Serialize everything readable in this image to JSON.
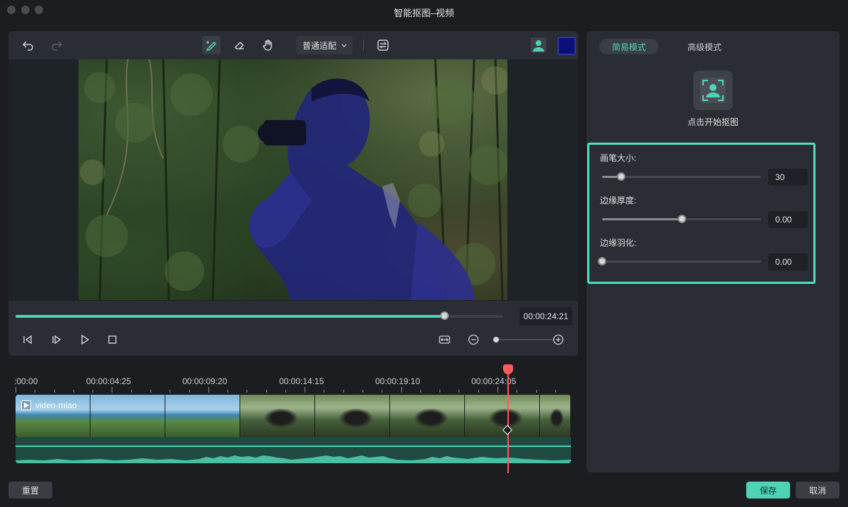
{
  "window": {
    "title": "智能抠图–视频"
  },
  "toolbar": {
    "fit_mode": "普通适配",
    "brush_color": "#0b0f7c",
    "icons": [
      "undo-icon",
      "redo-icon",
      "smart-brush-icon",
      "eraser-icon",
      "hand-icon",
      "chevron-down-icon",
      "swap-icon",
      "person-icon"
    ]
  },
  "player": {
    "timecode": "00:00:24:21",
    "progress": 0.88,
    "zoom": 0.0,
    "icons": [
      "prev-frame-icon",
      "next-frame-icon",
      "play-icon",
      "stop-icon",
      "fit-timeline-icon",
      "zoom-out-icon",
      "zoom-in-icon"
    ]
  },
  "timeline": {
    "ruler_labels": [
      ":00:00",
      "00:00:04:25",
      "00:00:09:20",
      "00:00:14:15",
      "00:00:19:10",
      "00:00:24:05"
    ],
    "clip_name": "video-miao",
    "playhead": "00:00:24:21"
  },
  "panel": {
    "tabs": {
      "simple": "简易模式",
      "advanced": "高级模式"
    },
    "cutout_label": "点击开始抠图",
    "brush_size": {
      "label": "画笔大小:",
      "value": "30",
      "level": 0.12
    },
    "edge_thickness": {
      "label": "边缘厚度:",
      "value": "0.00",
      "level": 0.5
    },
    "edge_feather": {
      "label": "边缘羽化:",
      "value": "0.00",
      "level": 0.0
    }
  },
  "buttons": {
    "reset": "重置",
    "save": "保存",
    "cancel": "取消"
  },
  "colors": {
    "accent": "#4fd3b6",
    "playhead": "#ff5a5a",
    "highlight_border": "#4ee2bf"
  }
}
